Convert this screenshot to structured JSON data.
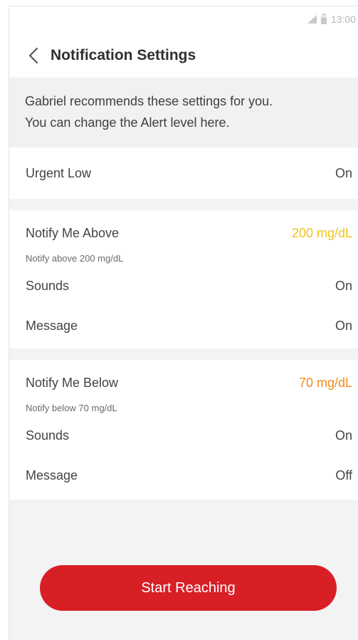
{
  "status_bar": {
    "time": "13:00"
  },
  "header": {
    "title": "Notification Settings"
  },
  "info": {
    "line1": "Gabriel recommends these settings for you.",
    "line2": "You can change the Alert level here."
  },
  "urgent_low": {
    "label": "Urgent Low",
    "value": "On"
  },
  "notify_above": {
    "label": "Notify Me Above",
    "value": "200 mg/dL",
    "value_color": "#f0c419",
    "description": "Notify above 200 mg/dL",
    "sounds_label": "Sounds",
    "sounds_value": "On",
    "message_label": "Message",
    "message_value": "On"
  },
  "notify_below": {
    "label": "Notify Me Below",
    "value": "70 mg/dL",
    "value_color": "#f08c1a",
    "description": "Notify below 70 mg/dL",
    "sounds_label": "Sounds",
    "sounds_value": "On",
    "message_label": "Message",
    "message_value": "Off"
  },
  "cta": {
    "label": "Start Reaching",
    "color": "#d81f26"
  }
}
